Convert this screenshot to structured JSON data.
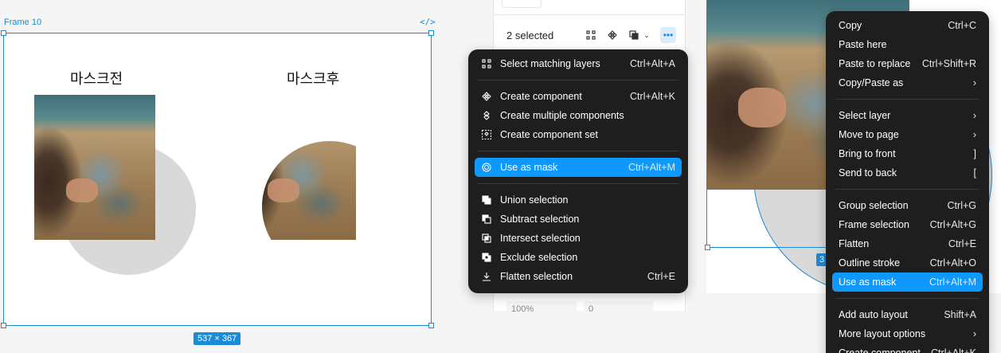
{
  "canvas": {
    "frame_label": "Frame 10",
    "code_icon": "</>",
    "size_badge": "537 × 367",
    "caption_before": "마스크전",
    "caption_after": "마스크후"
  },
  "panel": {
    "selected": "2 selected",
    "bottom_left": "100%",
    "bottom_mid": "0"
  },
  "menu_left": {
    "groups": [
      [
        {
          "label": "Select matching layers",
          "shortcut": "Ctrl+Alt+A",
          "icon": "select-matching-icon"
        }
      ],
      [
        {
          "label": "Create component",
          "shortcut": "Ctrl+Alt+K",
          "icon": "component-icon"
        },
        {
          "label": "Create multiple components",
          "shortcut": "",
          "icon": "multi-component-icon"
        },
        {
          "label": "Create component set",
          "shortcut": "",
          "icon": "component-set-icon"
        }
      ],
      [
        {
          "label": "Use as mask",
          "shortcut": "Ctrl+Alt+M",
          "icon": "mask-icon",
          "highlighted": true
        }
      ],
      [
        {
          "label": "Union selection",
          "shortcut": "",
          "icon": "union-icon"
        },
        {
          "label": "Subtract selection",
          "shortcut": "",
          "icon": "subtract-icon"
        },
        {
          "label": "Intersect selection",
          "shortcut": "",
          "icon": "intersect-icon"
        },
        {
          "label": "Exclude selection",
          "shortcut": "",
          "icon": "exclude-icon"
        },
        {
          "label": "Flatten selection",
          "shortcut": "Ctrl+E",
          "icon": "flatten-icon"
        }
      ]
    ]
  },
  "menu_right": {
    "groups": [
      [
        {
          "label": "Copy",
          "shortcut": "Ctrl+C"
        },
        {
          "label": "Paste here",
          "shortcut": ""
        },
        {
          "label": "Paste to replace",
          "shortcut": "Ctrl+Shift+R"
        },
        {
          "label": "Copy/Paste as",
          "shortcut": "›"
        }
      ],
      [
        {
          "label": "Select layer",
          "shortcut": "›"
        },
        {
          "label": "Move to page",
          "shortcut": "›"
        },
        {
          "label": "Bring to front",
          "shortcut": "]"
        },
        {
          "label": "Send to back",
          "shortcut": "["
        }
      ],
      [
        {
          "label": "Group selection",
          "shortcut": "Ctrl+G"
        },
        {
          "label": "Frame selection",
          "shortcut": "Ctrl+Alt+G"
        },
        {
          "label": "Flatten",
          "shortcut": "Ctrl+E"
        },
        {
          "label": "Outline stroke",
          "shortcut": "Ctrl+Alt+O"
        },
        {
          "label": "Use as mask",
          "shortcut": "Ctrl+Alt+M",
          "highlighted": true
        }
      ],
      [
        {
          "label": "Add auto layout",
          "shortcut": "Shift+A"
        },
        {
          "label": "More layout options",
          "shortcut": "›"
        },
        {
          "label": "Create component",
          "shortcut": "Ctrl+Alt+K"
        }
      ]
    ]
  },
  "right_canvas": {
    "badge": "3"
  }
}
